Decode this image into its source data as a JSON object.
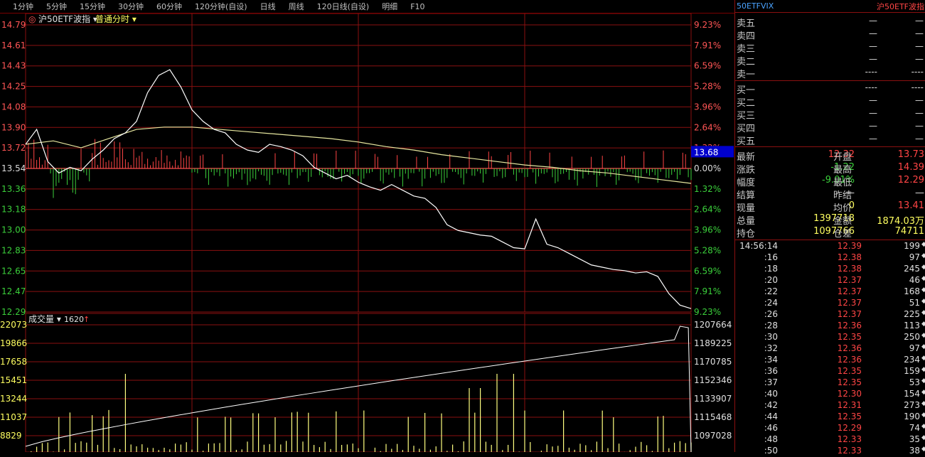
{
  "toolbar": {
    "periods": [
      "1分钟",
      "5分钟",
      "15分钟",
      "30分钟",
      "60分钟",
      "120分钟(自设)",
      "日线",
      "周线",
      "120日线(自设)",
      "明细",
      "F10"
    ]
  },
  "chart": {
    "title": "沪50ETF波指",
    "mode": "普通分时",
    "volume_label": "成交量",
    "volume_value": "1620",
    "current_price_tag": "13.68",
    "colors": {
      "grid": "#8a1010",
      "price": "#ffffff",
      "avg": "#e8e8a0",
      "up": "#ff4545",
      "down": "#3bd03b",
      "vol": "#ffff80"
    }
  },
  "chart_data": [
    {
      "type": "line",
      "title": "沪50ETF波指",
      "y_left_ticks": [
        "14.79",
        "14.61",
        "14.43",
        "14.25",
        "14.08",
        "13.90",
        "13.72",
        "13.54",
        "13.36",
        "13.18",
        "13.00",
        "12.83",
        "12.65",
        "12.47",
        "12.29"
      ],
      "y_right_ticks": [
        "9.23%",
        "7.91%",
        "6.59%",
        "5.28%",
        "3.96%",
        "2.64%",
        "1.32%",
        "0.00%",
        "1.32%",
        "2.64%",
        "3.96%",
        "5.28%",
        "6.59%",
        "7.91%",
        "9.23%"
      ],
      "ylim": [
        12.29,
        14.79
      ],
      "pre_close": 13.54,
      "series": [
        {
          "name": "price",
          "x": [
            0,
            4,
            8,
            12,
            16,
            20,
            24,
            28,
            32,
            36,
            40,
            44,
            48,
            52,
            56,
            60,
            64,
            68,
            72,
            76,
            80,
            84,
            88,
            92,
            96,
            100,
            104,
            108,
            112,
            116,
            120,
            124,
            128,
            132,
            136,
            140,
            144,
            148,
            152,
            156,
            160,
            164,
            168,
            172,
            176,
            180,
            184,
            188,
            192,
            196,
            200,
            204,
            208,
            212,
            216,
            220,
            224,
            228,
            232,
            236,
            240
          ],
          "values": [
            13.75,
            13.88,
            13.6,
            13.5,
            13.55,
            13.52,
            13.62,
            13.7,
            13.8,
            13.85,
            13.95,
            14.2,
            14.35,
            14.4,
            14.25,
            14.05,
            13.95,
            13.88,
            13.85,
            13.75,
            13.7,
            13.68,
            13.75,
            13.73,
            13.7,
            13.65,
            13.55,
            13.5,
            13.45,
            13.48,
            13.42,
            13.38,
            13.35,
            13.4,
            13.35,
            13.3,
            13.28,
            13.2,
            13.05,
            13.0,
            12.98,
            12.96,
            12.95,
            12.9,
            12.85,
            12.84,
            13.1,
            12.88,
            12.85,
            12.8,
            12.75,
            12.7,
            12.68,
            12.66,
            12.65,
            12.63,
            12.64,
            12.6,
            12.45,
            12.35,
            12.32
          ]
        },
        {
          "name": "avg",
          "x": [
            0,
            10,
            20,
            30,
            40,
            50,
            60,
            70,
            80,
            90,
            100,
            110,
            120,
            130,
            140,
            150,
            160,
            170,
            180,
            190,
            200,
            210,
            220,
            230,
            240
          ],
          "values": [
            13.75,
            13.78,
            13.72,
            13.8,
            13.88,
            13.9,
            13.9,
            13.88,
            13.86,
            13.84,
            13.82,
            13.8,
            13.77,
            13.73,
            13.7,
            13.66,
            13.63,
            13.6,
            13.57,
            13.55,
            13.52,
            13.5,
            13.47,
            13.44,
            13.41
          ]
        }
      ]
    },
    {
      "type": "bar",
      "title": "成交量",
      "y_left_ticks": [
        "22073",
        "19866",
        "17658",
        "15451",
        "13244",
        "11037",
        "8829"
      ],
      "y_right_ticks": [
        "1207664",
        "1189225",
        "1170785",
        "1152346",
        "1133907",
        "1115468",
        "1097028"
      ],
      "ylim": [
        8829,
        22073
      ]
    }
  ],
  "quote": {
    "symbol": "50ETFVIX",
    "name": "沪50ETF波指",
    "sells": [
      {
        "label": "卖五",
        "price": "—",
        "vol": "—"
      },
      {
        "label": "卖四",
        "price": "—",
        "vol": "—"
      },
      {
        "label": "卖三",
        "price": "—",
        "vol": "—"
      },
      {
        "label": "卖二",
        "price": "—",
        "vol": "—"
      },
      {
        "label": "卖一",
        "price": "----",
        "vol": "----"
      }
    ],
    "buys": [
      {
        "label": "买一",
        "price": "----",
        "vol": "----"
      },
      {
        "label": "买二",
        "price": "—",
        "vol": "—"
      },
      {
        "label": "买三",
        "price": "—",
        "vol": "—"
      },
      {
        "label": "买四",
        "price": "—",
        "vol": "—"
      },
      {
        "label": "买五",
        "price": "—",
        "vol": "—"
      }
    ],
    "stats": [
      {
        "l": "最新",
        "lv": "12.32",
        "lc": "#ff4545",
        "r": "开盘",
        "rv": "13.73",
        "rc": "#ff4545"
      },
      {
        "l": "涨跌",
        "lv": "-1.22",
        "lc": "#3bd03b",
        "r": "最高",
        "rv": "14.39",
        "rc": "#ff4545"
      },
      {
        "l": "幅度",
        "lv": "-9.01%",
        "lc": "#3bd03b",
        "r": "最低",
        "rv": "12.29",
        "rc": "#ff4545"
      },
      {
        "l": "结算",
        "lv": "—",
        "lc": "#e0e0e0",
        "r": "昨结",
        "rv": "—",
        "rc": "#e0e0e0"
      },
      {
        "l": "现量",
        "lv": "0",
        "lc": "#ffff60",
        "r": "均价",
        "rv": "13.41",
        "rc": "#ff4545"
      },
      {
        "l": "总量",
        "lv": "1397718",
        "lc": "#ffff60",
        "r": "金额",
        "rv": "1874.03万",
        "rc": "#ffff60"
      },
      {
        "l": "持仓",
        "lv": "1097766",
        "lc": "#ffff60",
        "r": "仓差",
        "rv": "74711",
        "rc": "#ffff60"
      }
    ],
    "ticks": [
      {
        "t": "14:56:14",
        "p": "12.39",
        "v": "199"
      },
      {
        "t": ":16",
        "p": "12.38",
        "v": "97"
      },
      {
        "t": ":18",
        "p": "12.38",
        "v": "245"
      },
      {
        "t": ":20",
        "p": "12.37",
        "v": "46"
      },
      {
        "t": ":22",
        "p": "12.37",
        "v": "168"
      },
      {
        "t": ":24",
        "p": "12.37",
        "v": "51"
      },
      {
        "t": ":26",
        "p": "12.37",
        "v": "225"
      },
      {
        "t": ":28",
        "p": "12.36",
        "v": "113"
      },
      {
        "t": ":30",
        "p": "12.35",
        "v": "250"
      },
      {
        "t": ":32",
        "p": "12.36",
        "v": "97"
      },
      {
        "t": ":34",
        "p": "12.36",
        "v": "234"
      },
      {
        "t": ":36",
        "p": "12.35",
        "v": "159"
      },
      {
        "t": ":37",
        "p": "12.35",
        "v": "53"
      },
      {
        "t": ":40",
        "p": "12.30",
        "v": "154"
      },
      {
        "t": ":42",
        "p": "12.31",
        "v": "273"
      },
      {
        "t": ":44",
        "p": "12.35",
        "v": "190"
      },
      {
        "t": ":46",
        "p": "12.29",
        "v": "74"
      },
      {
        "t": ":48",
        "p": "12.33",
        "v": "35"
      },
      {
        "t": ":50",
        "p": "12.33",
        "v": "38"
      }
    ]
  }
}
